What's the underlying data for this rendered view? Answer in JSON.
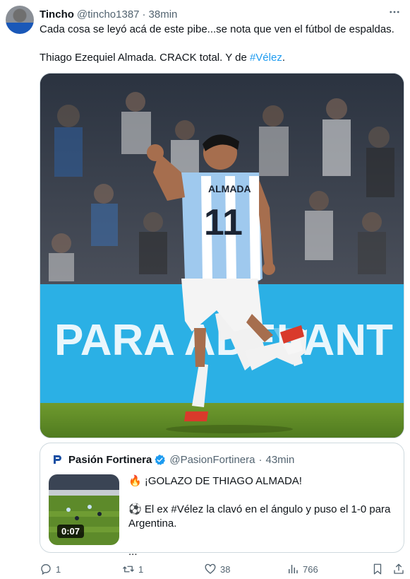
{
  "tweet": {
    "author_name": "Tincho",
    "author_handle": "@tincho1387",
    "separator": "·",
    "time": "38min",
    "text_line1": "Cada cosa se leyó acá de este pibe...se nota que ven el fútbol de espaldas.",
    "text_line2_prefix": "Thiago Ezequiel Almada. CRACK total. Y de ",
    "text_line2_tag": "#Vélez",
    "text_line2_suffix": ".",
    "more_icon": "more-dots-icon"
  },
  "media": {
    "jersey_name": "ALMADA",
    "jersey_number": "11",
    "banner_text": "PARA ADELANT"
  },
  "quote": {
    "author_name": "Pasión Fortinera",
    "author_handle": "@PasionFortinera",
    "separator": "·",
    "time": "43min",
    "video_duration": "0:07",
    "line1": "🔥 ¡GOLAZO DE THIAGO ALMADA!",
    "line2": "⚽ El ex #Vélez la clavó en el ángulo y puso el 1-0 para Argentina.",
    "line3": "..."
  },
  "actions": {
    "replies": "1",
    "retweets": "1",
    "likes": "38",
    "views": "766"
  },
  "colors": {
    "link": "#1d9bf0",
    "muted": "#536471",
    "verified": "#1d9bf0"
  }
}
